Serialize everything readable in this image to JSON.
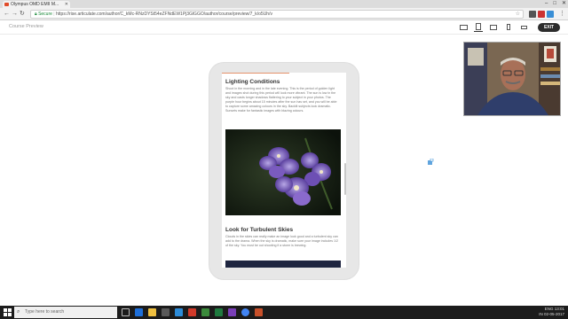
{
  "browser": {
    "tab_title": "Olympus OMD EMII M...",
    "url_secure_label": "Secure",
    "url": "https://rise.articulate.com/author/C_kMc-RNzDYSt54eZFNdEW1Pj3GlGGO/author/course/preview/7_k/o5Uh/v",
    "window_controls": [
      "–",
      "□",
      "✕"
    ]
  },
  "app": {
    "title": "Course Preview",
    "exit_label": "EXIT",
    "devices": [
      "desktop",
      "tablet-landscape-active",
      "tablet-portrait",
      "phone",
      "phone-landscape"
    ]
  },
  "lesson": {
    "section1_heading": "Lighting Conditions",
    "section1_body": "Shoot in the morning and in the late evening. This is the period of golden light and images shot during this period will look more vibrant. The sun is low in the sky and casts longer shadows flattering to your subject in your photos. The purple hour begins about 15 minutes after the sun has set, and you will be able to capture some amazing colours in the sky. Backlit subjects look dramatic. Sunsets make for fantastic images with blazing colours.",
    "section2_heading": "Look for Turbulent Skies",
    "section2_body": "Clouds in the skies can really make an image look good and a turbulent sky can add to the drama. When the sky is dramatic, make sure your image includes 1/2 of the sky. You must be out shooting if a storm is brewing."
  },
  "taskbar": {
    "search_placeholder": "Type here to search",
    "tray_lang": "ENG",
    "tray_region": "IN",
    "time": "13:01",
    "date": "02-05-2017"
  },
  "colors": {
    "accent": "#e5926b",
    "exit_bg": "#2c2c2c",
    "taskbar": "#1c1c1c"
  }
}
